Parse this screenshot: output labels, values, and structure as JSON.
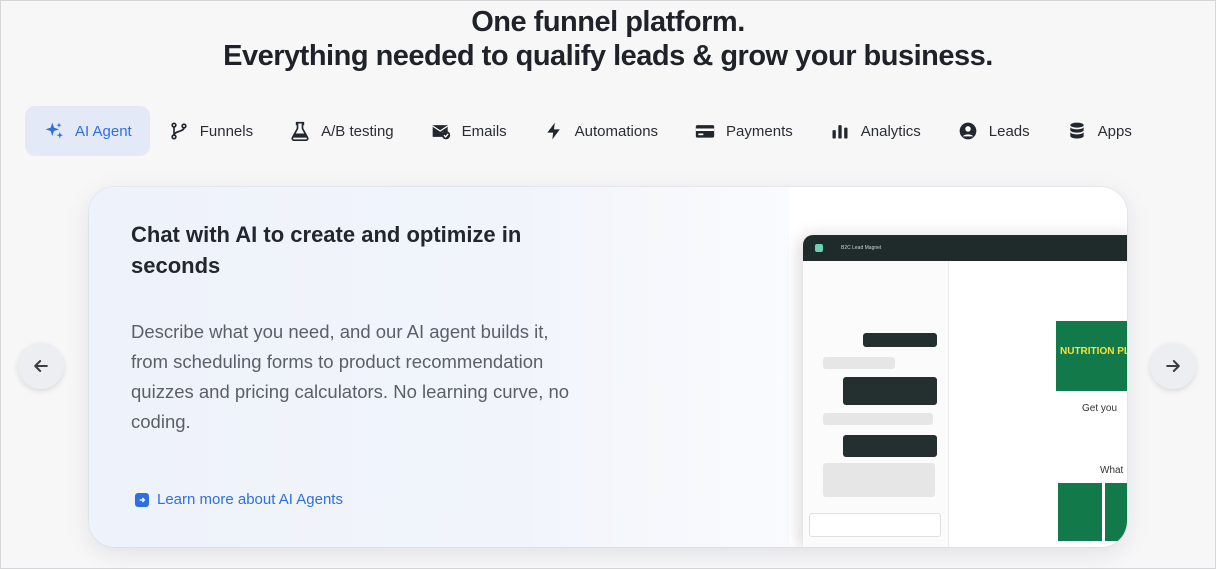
{
  "headline": {
    "line1": "One funnel platform.",
    "line2": "Everything needed to qualify leads & grow your business."
  },
  "tabs": [
    {
      "label": "AI Agent",
      "icon": "sparkle-icon",
      "active": true
    },
    {
      "label": "Funnels",
      "icon": "branch-icon"
    },
    {
      "label": "A/B testing",
      "icon": "flask-icon"
    },
    {
      "label": "Emails",
      "icon": "mail-check-icon"
    },
    {
      "label": "Automations",
      "icon": "lightning-icon"
    },
    {
      "label": "Payments",
      "icon": "credit-card-icon"
    },
    {
      "label": "Analytics",
      "icon": "bar-chart-icon"
    },
    {
      "label": "Leads",
      "icon": "user-circle-icon"
    },
    {
      "label": "Apps",
      "icon": "database-icon"
    }
  ],
  "card": {
    "title": "Chat with AI to create and optimize in seconds",
    "description": "Describe what you need, and our AI agent builds it, from scheduling forms to product recommendation quizzes and pricing calculators. No learning curve, no coding.",
    "link": "Learn more about AI Agents"
  },
  "mockup": {
    "tab": "B2C Lead Magnet",
    "plan_title": "NUTRITION PLAN",
    "get_text": "Get you",
    "what_text": "What"
  },
  "colors": {
    "accent": "#2f6fe0",
    "active_tab_bg": "#e3e9f6",
    "green": "#127a4a",
    "yellow": "#f4e23a"
  }
}
